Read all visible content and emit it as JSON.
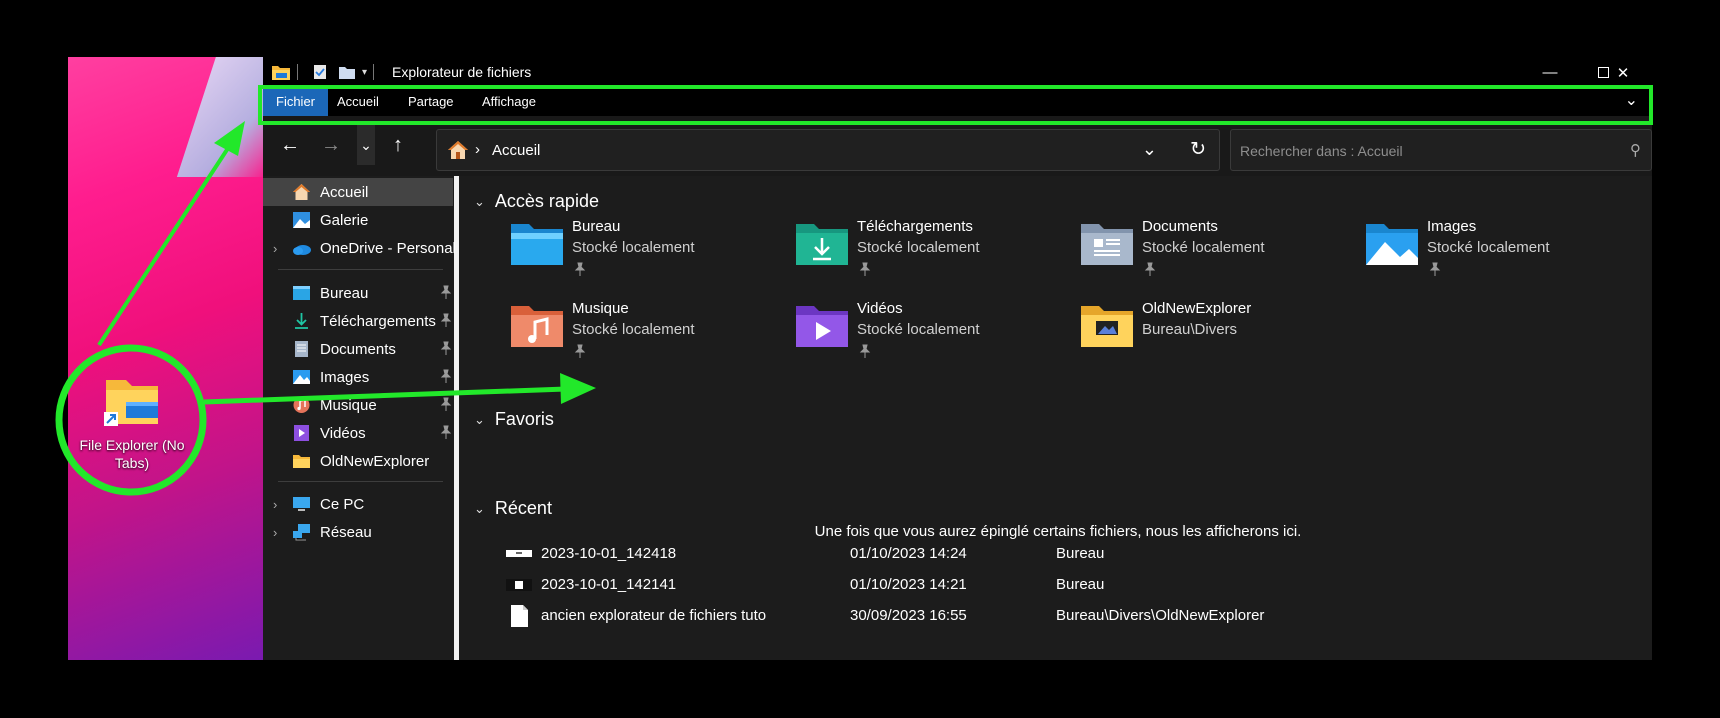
{
  "window": {
    "title": "Explorateur de fichiers",
    "accent_color": "#1b67b8",
    "minimize_icon": "minimize-icon",
    "maximize_icon": "maximize-icon",
    "close_icon": "close-icon"
  },
  "desktop": {
    "shortcut_label": "File Explorer (No Tabs)"
  },
  "ribbon": {
    "tabs": [
      "Fichier",
      "Accueil",
      "Partage",
      "Affichage"
    ]
  },
  "address": {
    "crumb": "Accueil",
    "search_placeholder": "Rechercher dans : Accueil"
  },
  "sidebar": {
    "items": [
      {
        "label": "Accueil",
        "icon": "home-icon",
        "selected": true
      },
      {
        "label": "Galerie",
        "icon": "gallery-icon"
      },
      {
        "label": "OneDrive - Personal",
        "icon": "onedrive-icon",
        "expandable": true
      },
      {
        "label": "Bureau",
        "icon": "desktop-folder-icon",
        "pinned": true
      },
      {
        "label": "Téléchargements",
        "icon": "download-icon",
        "pinned": true
      },
      {
        "label": "Documents",
        "icon": "documents-icon",
        "pinned": true
      },
      {
        "label": "Images",
        "icon": "pictures-icon",
        "pinned": true
      },
      {
        "label": "Musique",
        "icon": "music-icon",
        "pinned": true
      },
      {
        "label": "Vidéos",
        "icon": "videos-icon",
        "pinned": true
      },
      {
        "label": "OldNewExplorer",
        "icon": "folder-icon"
      },
      {
        "label": "Ce PC",
        "icon": "pc-icon",
        "expandable": true
      },
      {
        "label": "Réseau",
        "icon": "network-icon",
        "expandable": true
      }
    ]
  },
  "main": {
    "quick_access_title": "Accès rapide",
    "favorites_title": "Favoris",
    "recent_title": "Récent",
    "favorites_empty": "Une fois que vous aurez épinglé certains fichiers, nous les afficherons ici.",
    "quick_access": [
      {
        "name": "Bureau",
        "sub": "Stocké localement",
        "pinned": true,
        "icon": "desktop-folder-icon"
      },
      {
        "name": "Téléchargements",
        "sub": "Stocké localement",
        "pinned": true,
        "icon": "download-folder-icon"
      },
      {
        "name": "Documents",
        "sub": "Stocké localement",
        "pinned": true,
        "icon": "documents-folder-icon"
      },
      {
        "name": "Images",
        "sub": "Stocké localement",
        "pinned": true,
        "icon": "pictures-folder-icon"
      },
      {
        "name": "Musique",
        "sub": "Stocké localement",
        "pinned": true,
        "icon": "music-folder-icon"
      },
      {
        "name": "Vidéos",
        "sub": "Stocké localement",
        "pinned": true,
        "icon": "videos-folder-icon"
      },
      {
        "name": "OldNewExplorer",
        "sub": "Bureau\\Divers",
        "pinned": false,
        "icon": "folder-icon"
      }
    ],
    "recent": [
      {
        "name": "2023-10-01_142418",
        "date": "01/10/2023 14:24",
        "location": "Bureau",
        "icon": "image-file-icon"
      },
      {
        "name": "2023-10-01_142141",
        "date": "01/10/2023 14:21",
        "location": "Bureau",
        "icon": "image-file-icon"
      },
      {
        "name": "ancien explorateur de fichiers tuto",
        "date": "30/09/2023 16:55",
        "location": "Bureau\\Divers\\OldNewExplorer",
        "icon": "document-file-icon"
      }
    ]
  },
  "annotation_color": "#22e82a"
}
